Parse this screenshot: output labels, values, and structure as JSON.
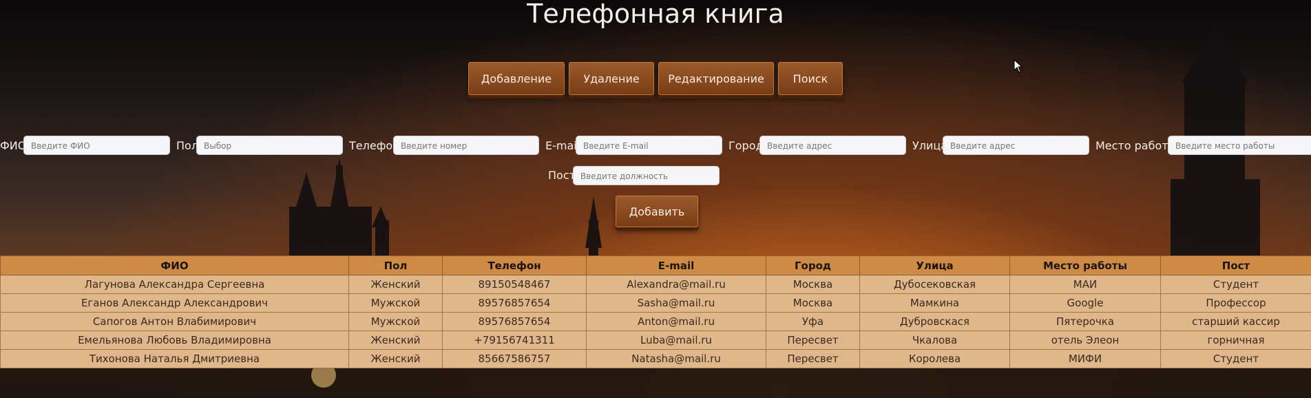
{
  "app": {
    "title": "Телефонная книга"
  },
  "tabs": [
    {
      "label": "Добавление"
    },
    {
      "label": "Удаление"
    },
    {
      "label": "Редактирование"
    },
    {
      "label": "Поиск"
    }
  ],
  "form": {
    "fio": {
      "label": "ФИО",
      "placeholder": "Введите ФИО"
    },
    "gender": {
      "label": "Пол",
      "placeholder": "Выбор"
    },
    "phone": {
      "label": "Телефон",
      "placeholder": "Введите номер"
    },
    "email": {
      "label": "E-mail",
      "placeholder": "Введите E-mail"
    },
    "city": {
      "label": "Город",
      "placeholder": "Введите адрес"
    },
    "street": {
      "label": "Улица",
      "placeholder": "Введите адрес"
    },
    "work": {
      "label": "Место работы",
      "placeholder": "Введите место работы"
    },
    "post": {
      "label": "Пост",
      "placeholder": "Введите должность"
    },
    "submit_label": "Добавить"
  },
  "table": {
    "headers": [
      "ФИО",
      "Пол",
      "Телефон",
      "E-mail",
      "Город",
      "Улица",
      "Место работы",
      "Пост"
    ],
    "rows": [
      [
        "Лагунова Александра Сергеевна",
        "Женский",
        "89150548467",
        "Alexandra@mail.ru",
        "Москва",
        "Дубосековская",
        "МАИ",
        "Студент"
      ],
      [
        "Еганов Александр Александрович",
        "Мужской",
        "89576857654",
        "Sasha@mail.ru",
        "Москва",
        "Мамкина",
        "Google",
        "Профессор"
      ],
      [
        "Сапогов Антон Влабимирович",
        "Мужской",
        "89576857654",
        "Anton@mail.ru",
        "Уфа",
        "Дубровскася",
        "Пятерочка",
        "старший кассир"
      ],
      [
        "Емельянова Любовь Владимировна",
        "Женский",
        "+79156741311",
        "Luba@mail.ru",
        "Пересвет",
        "Чкалова",
        "отель Элеон",
        "горничная"
      ],
      [
        "Тихонова Наталья Дмитриевна",
        "Женский",
        "85667586757",
        "Natasha@mail.ru",
        "Пересвет",
        "Королева",
        "МИФИ",
        "Студент"
      ]
    ]
  },
  "colors": {
    "accent": "#cf8a45",
    "button": "#7a3c16",
    "row": "#dfb78a"
  }
}
